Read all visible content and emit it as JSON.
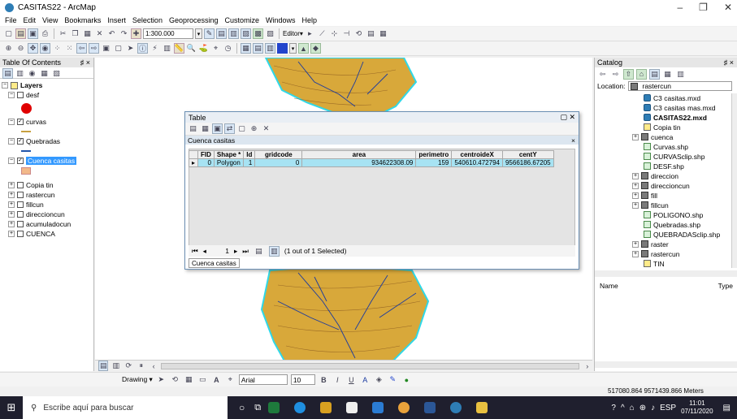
{
  "window": {
    "title": "CASITAS22 - ArcMap",
    "controls": [
      "–",
      "❐",
      "✕"
    ]
  },
  "menu": [
    "File",
    "Edit",
    "View",
    "Bookmarks",
    "Insert",
    "Selection",
    "Geoprocessing",
    "Customize",
    "Windows",
    "Help"
  ],
  "toolbar": {
    "scale": "1:300.000",
    "editor_label": "Editor▾"
  },
  "toc": {
    "title": "Table Of Contents",
    "pin": "♯ ×",
    "layers_root": "Layers",
    "items": [
      {
        "label": "desf",
        "checked": false,
        "expanded": true
      },
      {
        "label": "curvas",
        "checked": true,
        "expanded": true
      },
      {
        "label": "Quebradas",
        "checked": true,
        "expanded": true
      },
      {
        "label": "Cuenca casitas",
        "checked": true,
        "expanded": true,
        "selected": true
      },
      {
        "label": "Copia tin",
        "checked": false,
        "expanded": false
      },
      {
        "label": "rastercun",
        "checked": false,
        "expanded": false
      },
      {
        "label": "fillcun",
        "checked": false,
        "expanded": false
      },
      {
        "label": "direccioncun",
        "checked": false,
        "expanded": false
      },
      {
        "label": "acumuladocun",
        "checked": false,
        "expanded": false
      },
      {
        "label": "CUENCA",
        "checked": false,
        "expanded": false
      }
    ]
  },
  "table_window": {
    "title": "Table",
    "table_name": "Cuenca casitas",
    "columns": [
      "FID",
      "Shape *",
      "Id",
      "gridcode",
      "area",
      "perimetro",
      "centroideX",
      "centY"
    ],
    "rows": [
      [
        "0",
        "Polygon",
        "1",
        "0",
        "934622308.09",
        "159",
        "540610.472794",
        "9566186.67205"
      ]
    ],
    "record_pos": "1",
    "selection_status": "(1 out of 1 Selected)",
    "tab_label": "Cuenca casitas"
  },
  "catalog": {
    "title": "Catalog",
    "pin": "♯ ×",
    "location_label": "Location:",
    "location_value": "rastercun",
    "items": [
      {
        "label": "C3 casitas.mxd",
        "icon": "mxd",
        "indent": 1,
        "bold": false
      },
      {
        "label": "C3 casitas mas.mxd",
        "icon": "mxd",
        "indent": 1,
        "bold": false
      },
      {
        "label": "CASITAS22.mxd",
        "icon": "mxd",
        "indent": 1,
        "bold": true
      },
      {
        "label": "Copia tin",
        "icon": "tin",
        "indent": 1,
        "bold": false
      },
      {
        "label": "cuenca",
        "icon": "raster",
        "indent": 0,
        "bold": false
      },
      {
        "label": "Curvas.shp",
        "icon": "shp",
        "indent": 1,
        "bold": false
      },
      {
        "label": "CURVASclip.shp",
        "icon": "shp",
        "indent": 1,
        "bold": false
      },
      {
        "label": "DESF.shp",
        "icon": "shp",
        "indent": 1,
        "bold": false
      },
      {
        "label": "direccion",
        "icon": "raster",
        "indent": 0,
        "bold": false
      },
      {
        "label": "direccioncun",
        "icon": "raster",
        "indent": 0,
        "bold": false
      },
      {
        "label": "fill",
        "icon": "raster",
        "indent": 0,
        "bold": false
      },
      {
        "label": "fillcun",
        "icon": "raster",
        "indent": 0,
        "bold": false
      },
      {
        "label": "POLIGONO.shp",
        "icon": "shp",
        "indent": 1,
        "bold": false
      },
      {
        "label": "Quebradas.shp",
        "icon": "shp",
        "indent": 1,
        "bold": false
      },
      {
        "label": "QUEBRADASclip.shp",
        "icon": "shp",
        "indent": 1,
        "bold": false
      },
      {
        "label": "raster",
        "icon": "raster",
        "indent": 0,
        "bold": false
      },
      {
        "label": "rastercun",
        "icon": "raster",
        "indent": 0,
        "bold": false
      },
      {
        "label": "TIN",
        "icon": "tin",
        "indent": 1,
        "bold": false
      }
    ],
    "details_columns": [
      "Name",
      "Type"
    ]
  },
  "drawing": {
    "label": "Drawing ▾",
    "font": "Arial",
    "size": "10"
  },
  "status": {
    "coords": "517080.864  9571439.866 Meters"
  },
  "taskbar": {
    "search_placeholder": "Escribe aquí para buscar",
    "lang": "ESP",
    "time": "11:01",
    "date": "07/11/2020"
  },
  "colors": {
    "selected_row": "#a7e3f3",
    "toc_selected": "#3399ff",
    "basin_fill": "#d8a83a",
    "taskbar": "#1f1f2e"
  }
}
